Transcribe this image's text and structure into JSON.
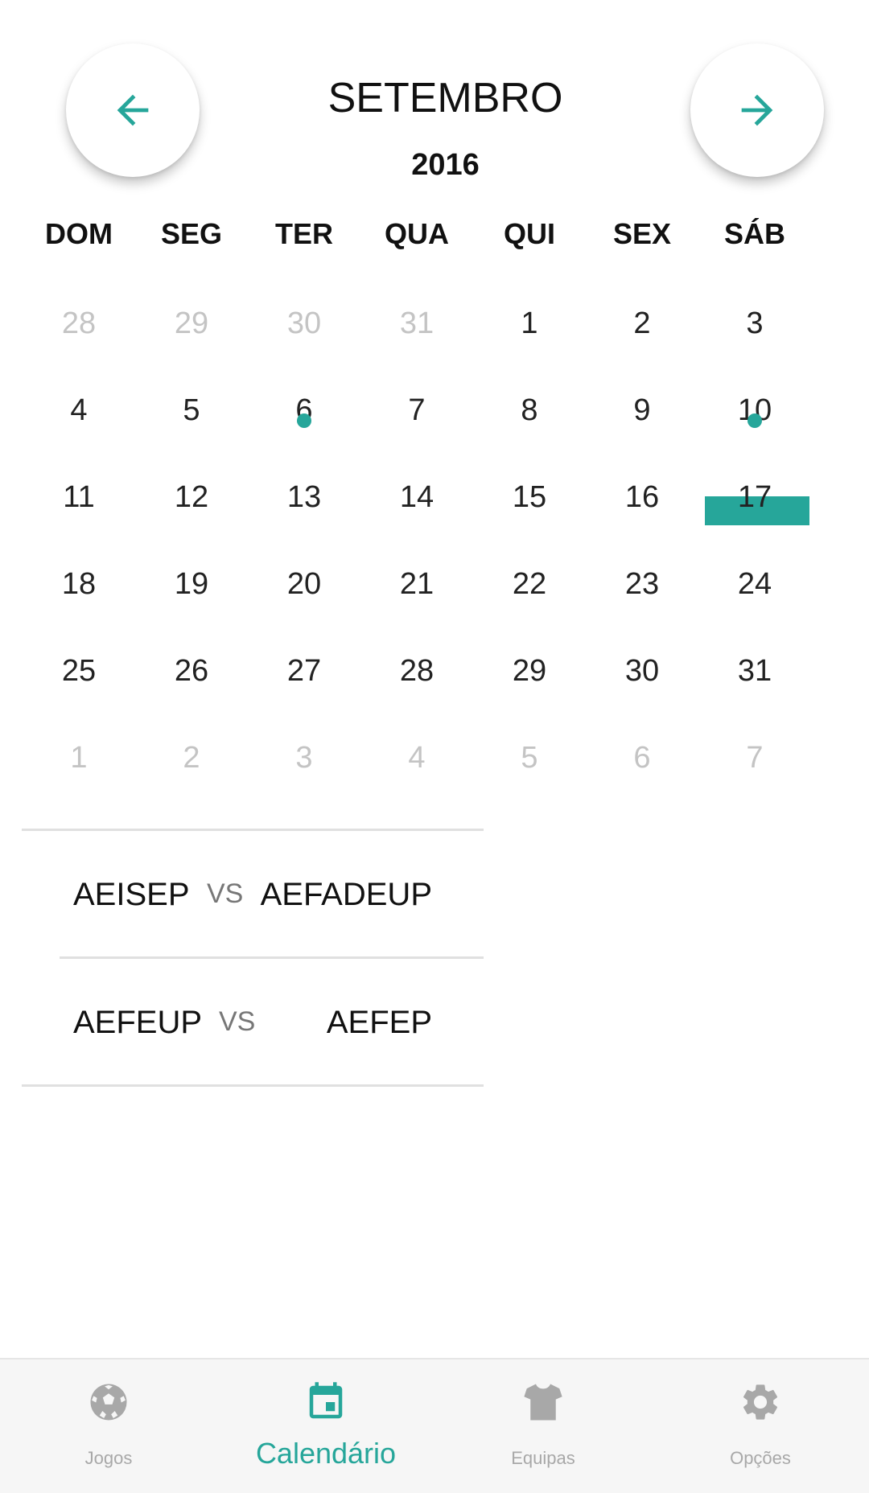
{
  "header": {
    "month": "SETEMBRO",
    "year": "2016",
    "prev_icon": "arrow-left-icon",
    "next_icon": "arrow-right-icon"
  },
  "weekdays": [
    "DOM",
    "SEG",
    "TER",
    "QUA",
    "QUI",
    "SEX",
    "SÁB"
  ],
  "days": [
    {
      "label": "28",
      "muted": true
    },
    {
      "label": "29",
      "muted": true
    },
    {
      "label": "30",
      "muted": true
    },
    {
      "label": "31",
      "muted": true
    },
    {
      "label": "1"
    },
    {
      "label": "2"
    },
    {
      "label": "3"
    },
    {
      "label": "4"
    },
    {
      "label": "5"
    },
    {
      "label": "6",
      "event": true
    },
    {
      "label": "7"
    },
    {
      "label": "8"
    },
    {
      "label": "9"
    },
    {
      "label": "10",
      "event": true
    },
    {
      "label": "11"
    },
    {
      "label": "12"
    },
    {
      "label": "13"
    },
    {
      "label": "14"
    },
    {
      "label": "15"
    },
    {
      "label": "16"
    },
    {
      "label": "17",
      "selected": true
    },
    {
      "label": "18"
    },
    {
      "label": "19"
    },
    {
      "label": "20"
    },
    {
      "label": "21"
    },
    {
      "label": "22"
    },
    {
      "label": "23"
    },
    {
      "label": "24"
    },
    {
      "label": "25"
    },
    {
      "label": "26"
    },
    {
      "label": "27"
    },
    {
      "label": "28"
    },
    {
      "label": "29"
    },
    {
      "label": "30"
    },
    {
      "label": "31"
    },
    {
      "label": "1",
      "muted": true
    },
    {
      "label": "2",
      "muted": true
    },
    {
      "label": "3",
      "muted": true
    },
    {
      "label": "4",
      "muted": true
    },
    {
      "label": "5",
      "muted": true
    },
    {
      "label": "6",
      "muted": true
    },
    {
      "label": "7",
      "muted": true
    }
  ],
  "matches": [
    {
      "home": "AEISEP",
      "vs": "VS",
      "away": "AEFADEUP"
    },
    {
      "home": "AEFEUP",
      "vs": "VS",
      "away": "AEFEP"
    }
  ],
  "bottom_nav": [
    {
      "label": "Jogos",
      "icon": "soccer-ball-icon",
      "active": false
    },
    {
      "label": "Calendário",
      "icon": "calendar-icon",
      "active": true
    },
    {
      "label": "Equipas",
      "icon": "shirt-icon",
      "active": false
    },
    {
      "label": "Opções",
      "icon": "gear-icon",
      "active": false
    }
  ],
  "colors": {
    "accent": "#26a69a",
    "muted_text": "#c4c4c4",
    "inactive_nav": "#a8a8a8"
  }
}
